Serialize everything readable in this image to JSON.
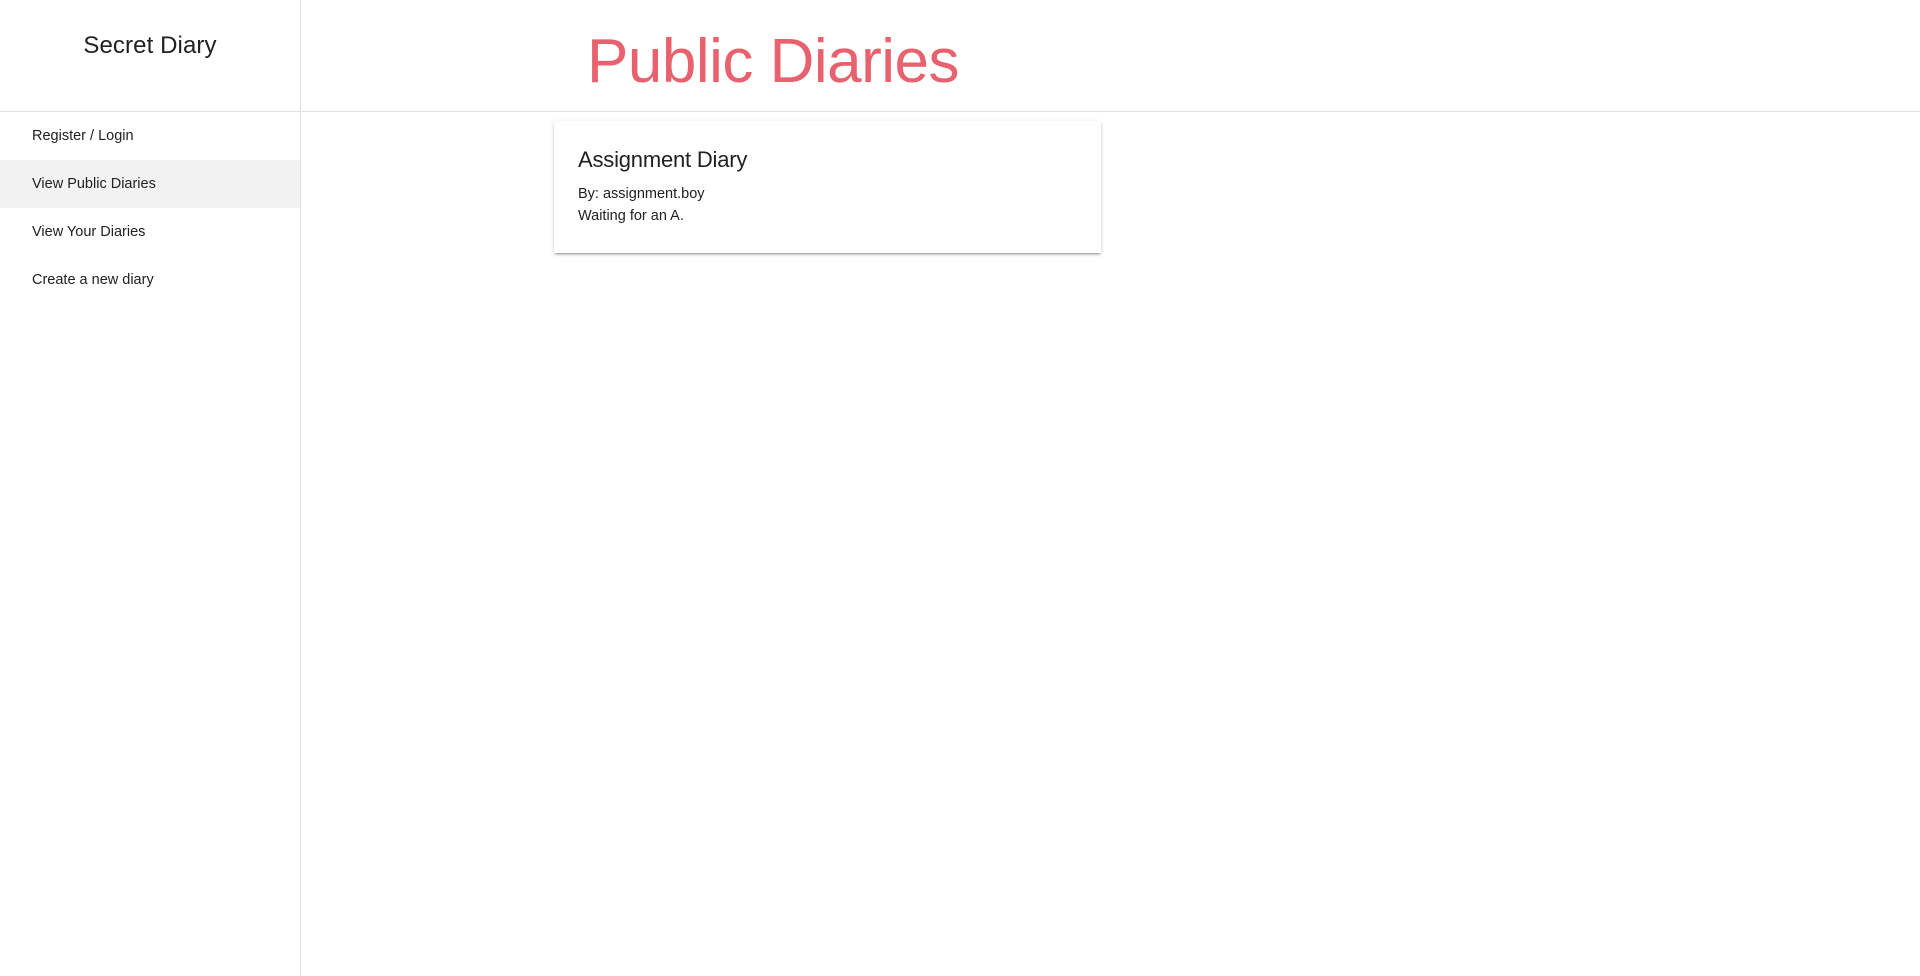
{
  "app": {
    "brand_title": "Secret Diary"
  },
  "sidebar": {
    "items": [
      {
        "label": "Register / Login",
        "active": false
      },
      {
        "label": "View Public Diaries",
        "active": true
      },
      {
        "label": "View Your Diaries",
        "active": false
      },
      {
        "label": "Create a new diary",
        "active": false
      }
    ]
  },
  "header": {
    "title": "Public Diaries"
  },
  "diaries": [
    {
      "title": "Assignment Diary",
      "author_line": "By: assignment.boy",
      "description": "Waiting for an A."
    }
  ],
  "colors": {
    "accent": "#e7626e",
    "active_nav_bg": "#f2f2f2",
    "divider": "#e0e0e0"
  }
}
